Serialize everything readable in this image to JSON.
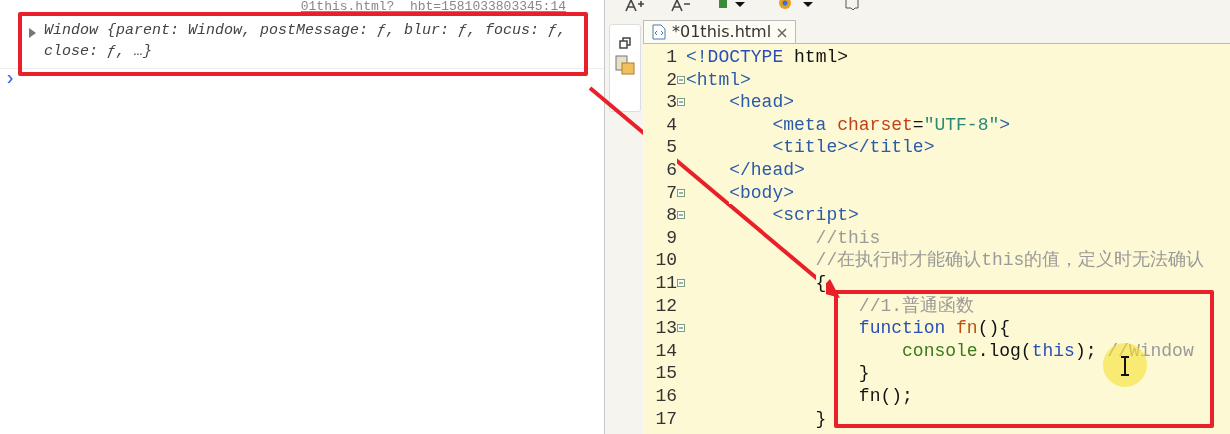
{
  "console": {
    "source_link": "01this.html?__hbt=1581033803345:14",
    "entries": [
      {
        "expanded": false,
        "lines": [
          "Window {parent: Window, postMessage: ƒ, blur: ƒ, focus: ƒ,",
          "close: ƒ, …}"
        ]
      }
    ],
    "prompt": "›"
  },
  "editor": {
    "tabs": [
      {
        "label": "*01this.html",
        "selected": true
      }
    ],
    "lines": [
      {
        "number": "1",
        "fold": false,
        "tokens": [
          {
            "text": "<!",
            "kind": "tag"
          },
          {
            "text": "DOCTYPE",
            "kind": "keyword"
          },
          {
            "text": " html>",
            "kind": "plain"
          }
        ]
      },
      {
        "number": "2",
        "fold": true,
        "tokens": [
          {
            "text": "<html>",
            "kind": "tag"
          }
        ]
      },
      {
        "number": "3",
        "fold": true,
        "tokens": [
          {
            "text": "    <head>",
            "kind": "tag"
          }
        ]
      },
      {
        "number": "4",
        "fold": false,
        "tokens": [
          {
            "text": "        <meta ",
            "kind": "tag"
          },
          {
            "text": "charset",
            "kind": "attr"
          },
          {
            "text": "=",
            "kind": "plain"
          },
          {
            "text": "\"UTF-8\"",
            "kind": "string"
          },
          {
            "text": ">",
            "kind": "tag"
          }
        ]
      },
      {
        "number": "5",
        "fold": false,
        "tokens": [
          {
            "text": "        <title></title>",
            "kind": "tag"
          }
        ]
      },
      {
        "number": "6",
        "fold": false,
        "tokens": [
          {
            "text": "    </head>",
            "kind": "tag"
          }
        ]
      },
      {
        "number": "7",
        "fold": true,
        "tokens": [
          {
            "text": "    <body>",
            "kind": "tag"
          }
        ]
      },
      {
        "number": "8",
        "fold": true,
        "tokens": [
          {
            "text": "        <script>",
            "kind": "tag"
          }
        ]
      },
      {
        "number": "9",
        "fold": false,
        "tokens": [
          {
            "text": "            //this",
            "kind": "comment"
          }
        ]
      },
      {
        "number": "10",
        "fold": false,
        "tokens": [
          {
            "text": "            //在执行时才能确认this的值，定义时无法确认",
            "kind": "comment"
          }
        ]
      },
      {
        "number": "11",
        "fold": true,
        "tokens": [
          {
            "text": "            {",
            "kind": "plain"
          }
        ]
      },
      {
        "number": "12",
        "fold": false,
        "tokens": [
          {
            "text": "                //1.普通函数",
            "kind": "comment"
          }
        ]
      },
      {
        "number": "13",
        "fold": true,
        "tokens": [
          {
            "text": "                function ",
            "kind": "keyword"
          },
          {
            "text": "fn",
            "kind": "func"
          },
          {
            "text": "(){",
            "kind": "plain"
          }
        ]
      },
      {
        "number": "14",
        "fold": false,
        "tokens": [
          {
            "text": "                    console",
            "kind": "object"
          },
          {
            "text": ".log(",
            "kind": "plain"
          },
          {
            "text": "this",
            "kind": "keyword"
          },
          {
            "text": "); ",
            "kind": "plain"
          },
          {
            "text": "//Window",
            "kind": "comment"
          }
        ]
      },
      {
        "number": "15",
        "fold": false,
        "tokens": [
          {
            "text": "                }",
            "kind": "plain"
          }
        ]
      },
      {
        "number": "16",
        "fold": false,
        "tokens": [
          {
            "text": "                fn();",
            "kind": "plain"
          }
        ]
      },
      {
        "number": "17",
        "fold": false,
        "tokens": [
          {
            "text": "            }",
            "kind": "plain"
          }
        ]
      }
    ]
  },
  "annotations": [
    {
      "kind": "box"
    },
    {
      "kind": "box"
    },
    {
      "kind": "arrow"
    }
  ]
}
